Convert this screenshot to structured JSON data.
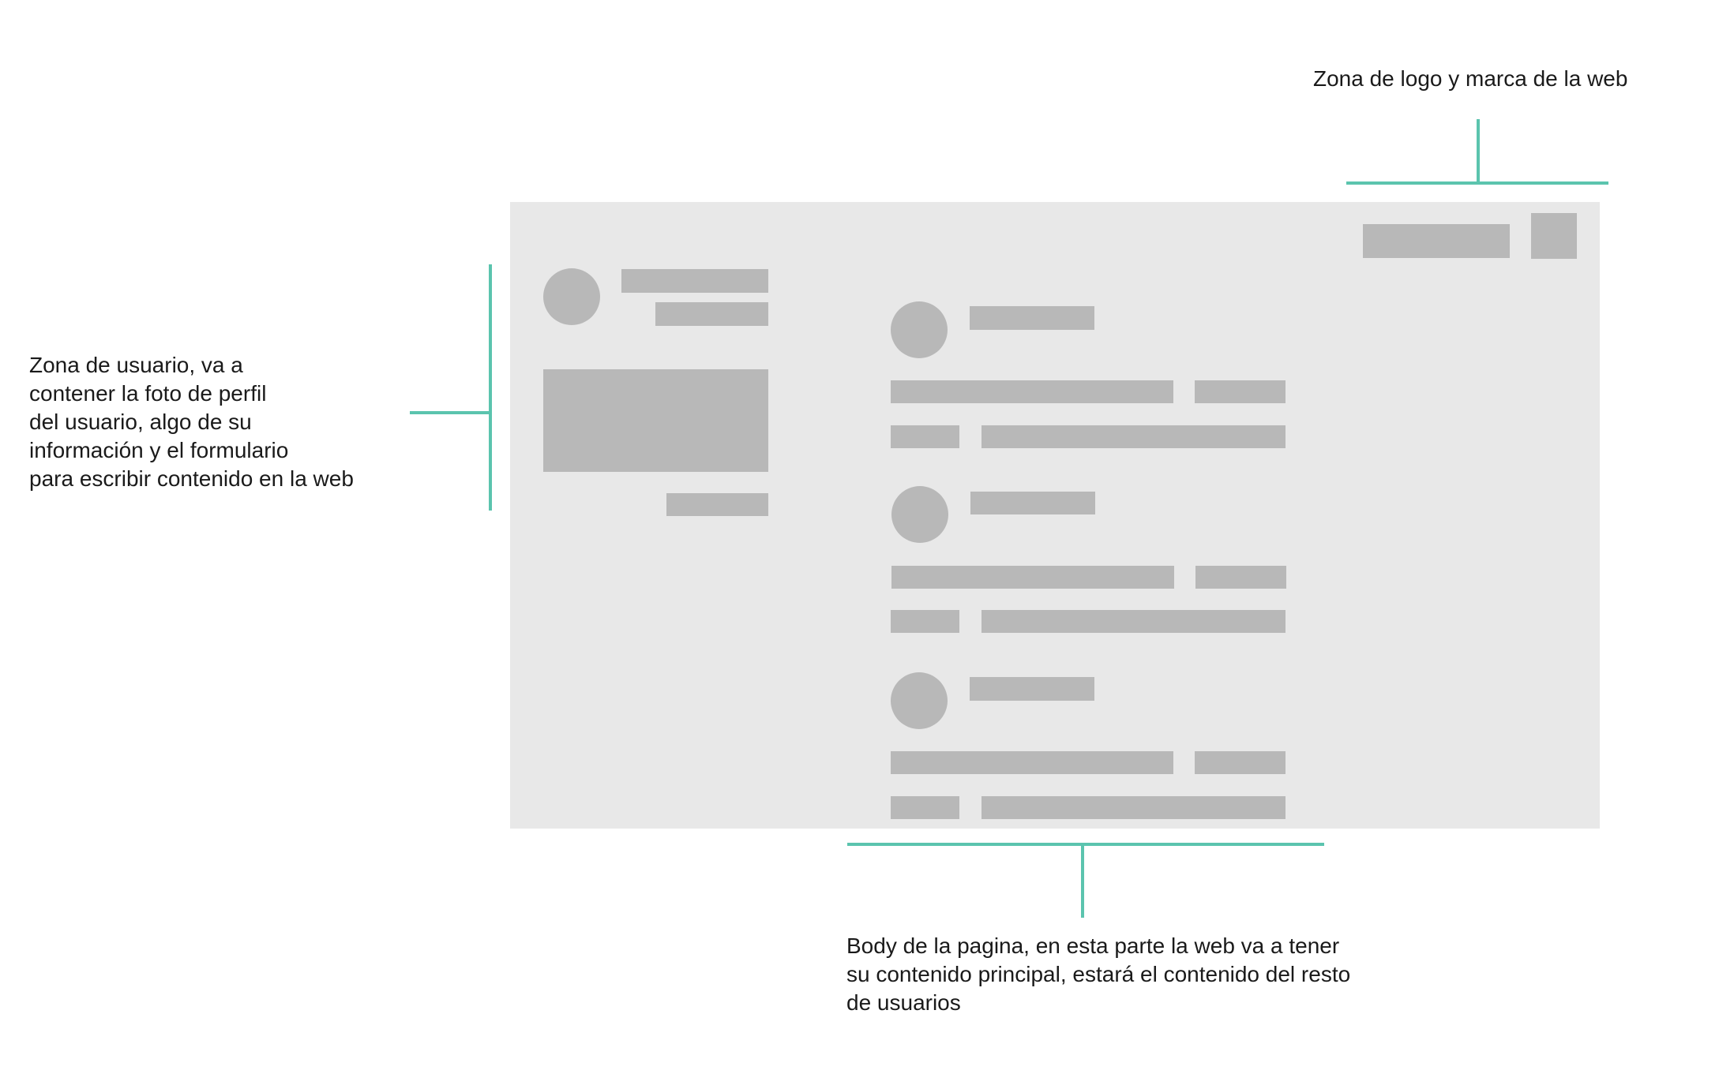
{
  "annotations": {
    "logo_zone": {
      "lines": [
        "Zona de logo y marca de la web"
      ]
    },
    "user_zone": {
      "lines": [
        "Zona de usuario, va a",
        "contener la foto de perfil",
        "del usuario, algo de su",
        "información y el formulario",
        "para escribir contenido en la web"
      ]
    },
    "body_zone": {
      "lines": [
        "Body de la pagina, en esta parte la web va a tener",
        "su contenido principal, estará el contenido del resto",
        "de usuarios"
      ]
    }
  },
  "colors": {
    "callout": "#5bc4ae",
    "frame_background": "#e8e8e8",
    "placeholder": "#b8b8b8",
    "text": "#1a1a1a"
  },
  "wireframe": {
    "header": {
      "items": [
        "logo-placeholder",
        "brand-icon-placeholder"
      ]
    },
    "user_panel": {
      "items": [
        "avatar",
        "name-line",
        "info-line",
        "compose-textarea",
        "submit-button"
      ]
    },
    "feed": {
      "post_count": 3
    }
  }
}
